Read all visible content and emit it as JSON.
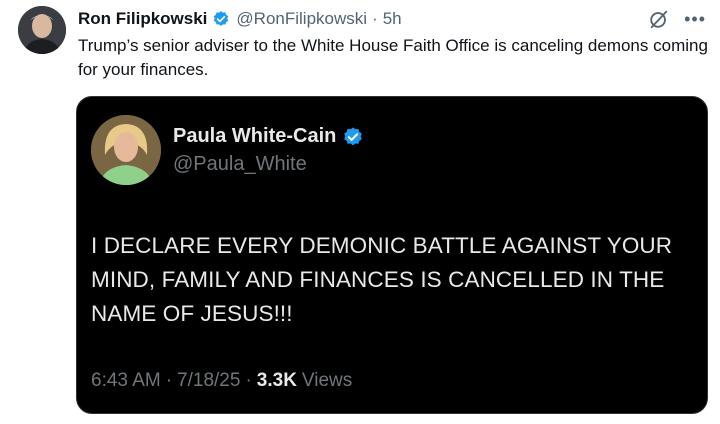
{
  "author": {
    "name": "Ron Filipkowski",
    "handle": "@RonFilipkowski",
    "separator": "·",
    "time": "5h"
  },
  "tweet": {
    "text": "Trump’s senior adviser to the White House Faith Office is canceling demons coming for your finances."
  },
  "quoted": {
    "name": "Paula White-Cain",
    "handle": "@Paula_White",
    "body": "I DECLARE EVERY DEMONIC BATTLE AGAINST YOUR MIND, FAMILY AND FINANCES IS CANCELLED IN THE NAME OF JESUS!!!",
    "time": "6:43 AM",
    "date": "7/18/25",
    "separator": "·",
    "views_count": "3.3K",
    "views_label": "Views"
  },
  "icons": {
    "verified": "verified-badge-icon",
    "grok": "grok-icon",
    "more": "more-icon"
  },
  "colors": {
    "verified_blue": "#1d9bf0",
    "card_bg": "#000000",
    "muted": "#536471"
  }
}
